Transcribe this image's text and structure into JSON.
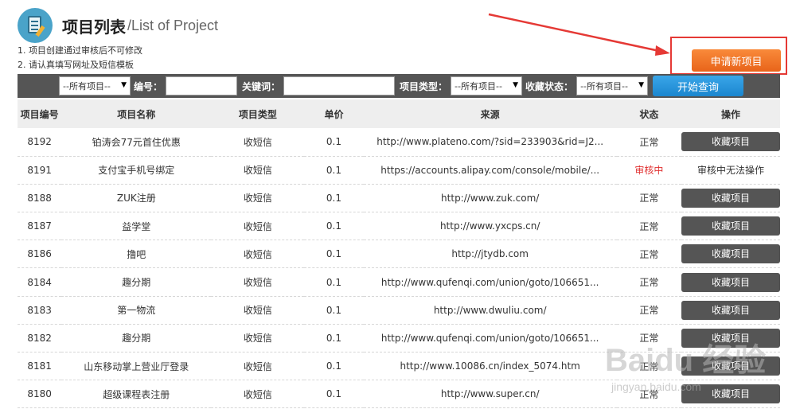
{
  "header": {
    "title_cn": "项目列表",
    "title_en": "/List of Project"
  },
  "notes": [
    "1. 项目创建通过审核后不可修改",
    "2. 请认真填写网址及短信模板"
  ],
  "apply_button_label": "申请新项目",
  "filters": {
    "category_select": "--所有项目--",
    "id_label": "编号：",
    "keyword_label": "关键词：",
    "type_label": "项目类型：",
    "type_select": "--所有项目--",
    "fav_status_label": "收藏状态：",
    "fav_status_select": "--所有项目--",
    "search_button": "开始查询"
  },
  "table": {
    "columns": [
      "项目编号",
      "项目名称",
      "项目类型",
      "单价",
      "来源",
      "状态",
      "操作"
    ],
    "rows": [
      {
        "id": "8192",
        "name": "铂涛会77元首住优惠",
        "type": "收短信",
        "price": "0.1",
        "source": "http://www.plateno.com/?sid=233903&rid=J2...",
        "status": "正常",
        "action": "收藏项目"
      },
      {
        "id": "8191",
        "name": "支付宝手机号绑定",
        "type": "收短信",
        "price": "0.1",
        "source": "https://accounts.alipay.com/console/mobile/...",
        "status": "审核中",
        "action": "审核中无法操作"
      },
      {
        "id": "8188",
        "name": "ZUK注册",
        "type": "收短信",
        "price": "0.1",
        "source": "http://www.zuk.com/",
        "status": "正常",
        "action": "收藏项目"
      },
      {
        "id": "8187",
        "name": "益学堂",
        "type": "收短信",
        "price": "0.1",
        "source": "http://www.yxcps.cn/",
        "status": "正常",
        "action": "收藏项目"
      },
      {
        "id": "8186",
        "name": "撸吧",
        "type": "收短信",
        "price": "0.1",
        "source": "http://jtydb.com",
        "status": "正常",
        "action": "收藏项目"
      },
      {
        "id": "8184",
        "name": "趣分期",
        "type": "收短信",
        "price": "0.1",
        "source": "http://www.qufenqi.com/union/goto/106651...",
        "status": "正常",
        "action": "收藏项目"
      },
      {
        "id": "8183",
        "name": "第一物流",
        "type": "收短信",
        "price": "0.1",
        "source": "http://www.dwuliu.com/",
        "status": "正常",
        "action": "收藏项目"
      },
      {
        "id": "8182",
        "name": "趣分期",
        "type": "收短信",
        "price": "0.1",
        "source": "http://www.qufenqi.com/union/goto/106651...",
        "status": "正常",
        "action": "收藏项目"
      },
      {
        "id": "8181",
        "name": "山东移动掌上营业厅登录",
        "type": "收短信",
        "price": "0.1",
        "source": "http://www.10086.cn/index_5074.htm",
        "status": "正常",
        "action": "收藏项目"
      },
      {
        "id": "8180",
        "name": "超级课程表注册",
        "type": "收短信",
        "price": "0.1",
        "source": "http://www.super.cn/",
        "status": "正常",
        "action": "收藏项目"
      }
    ]
  },
  "watermark": {
    "main": "Baidu 经验",
    "sub": "jingyan.baidu.com"
  },
  "colors": {
    "accent_orange": "#e8641a",
    "accent_blue": "#1b86cf",
    "bar_dark": "#555555",
    "status_review": "#e03030",
    "highlight_red": "#e53935"
  }
}
